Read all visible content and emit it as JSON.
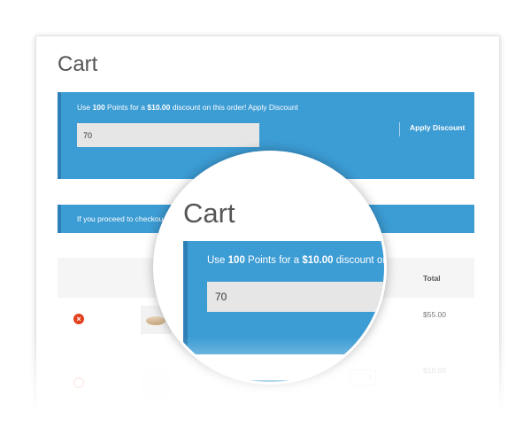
{
  "page": {
    "title": "Cart"
  },
  "points_notice": {
    "prefix": "Use ",
    "points": "100",
    "middle": " Points for a ",
    "discount": "$10.00",
    "suffix": " discount on this order! ",
    "link_text": "Apply Discount",
    "input_value": "70",
    "apply_button": "Apply Discount"
  },
  "checkout_notice": {
    "text": "If you proceed to checkou"
  },
  "cart_table": {
    "total_header": "Total",
    "rows": [
      {
        "total": "$55.00"
      },
      {
        "quantity": "1",
        "total": "$18.00"
      }
    ]
  },
  "magnifier": {
    "title": "Cart",
    "prefix": "Use ",
    "points": "100",
    "middle": " Points for a ",
    "discount": "$10.00",
    "suffix": " discount on t",
    "input_value": "70"
  },
  "colors": {
    "notice_bg": "#3c9cd4",
    "notice_border": "#2e7fb6",
    "remove_icon": "#e2401c"
  },
  "icons": {
    "remove": "remove-item-icon"
  }
}
